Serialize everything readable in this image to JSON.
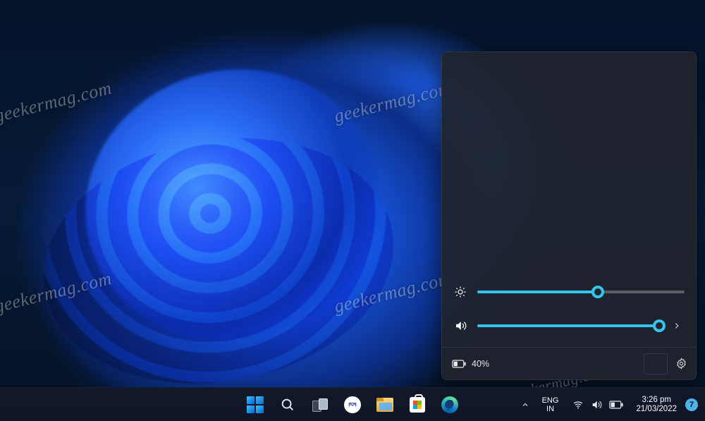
{
  "watermark": "geekermag.com",
  "quick_settings": {
    "brightness_percent": 58,
    "volume_percent": 100,
    "battery_text": "40%"
  },
  "taskbar": {
    "lang_line1": "ENG",
    "lang_line2": "IN",
    "time": "3:26 pm",
    "date": "21/03/2022",
    "notification_count": "7"
  }
}
